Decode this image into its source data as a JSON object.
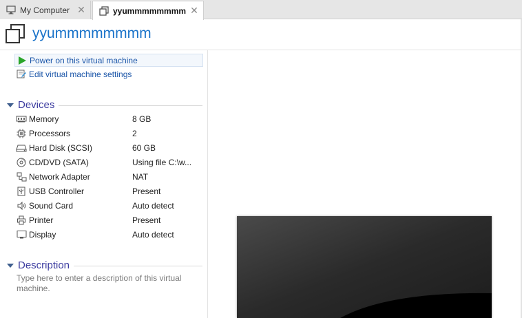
{
  "tabs": [
    {
      "label": "My Computer",
      "icon": "monitor-icon",
      "active": false
    },
    {
      "label": "yyummmmmmmm",
      "icon": "vm-icon",
      "active": true
    }
  ],
  "header": {
    "title": "yyummmmmmmm",
    "icon": "vm-icon"
  },
  "commands": {
    "power_on": "Power on this virtual machine",
    "edit_settings": "Edit virtual machine settings"
  },
  "devices": {
    "title": "Devices",
    "items": [
      {
        "name": "Memory",
        "value": "8 GB",
        "icon": "memory-icon"
      },
      {
        "name": "Processors",
        "value": "2",
        "icon": "processor-icon"
      },
      {
        "name": "Hard Disk (SCSI)",
        "value": "60 GB",
        "icon": "hard-disk-icon"
      },
      {
        "name": "CD/DVD (SATA)",
        "value": "Using file C:\\w...",
        "icon": "cd-dvd-icon"
      },
      {
        "name": "Network Adapter",
        "value": "NAT",
        "icon": "network-adapter-icon"
      },
      {
        "name": "USB Controller",
        "value": "Present",
        "icon": "usb-icon"
      },
      {
        "name": "Sound Card",
        "value": "Auto detect",
        "icon": "speaker-icon"
      },
      {
        "name": "Printer",
        "value": "Present",
        "icon": "printer-icon"
      },
      {
        "name": "Display",
        "value": "Auto detect",
        "icon": "display-icon"
      }
    ]
  },
  "description": {
    "title": "Description",
    "placeholder": "Type here to enter a description of this virtual machine."
  },
  "colors": {
    "accent": "#1a73c9",
    "link": "#1a55a8",
    "section_title": "#3c3ca0",
    "play_green": "#2aa52a"
  }
}
